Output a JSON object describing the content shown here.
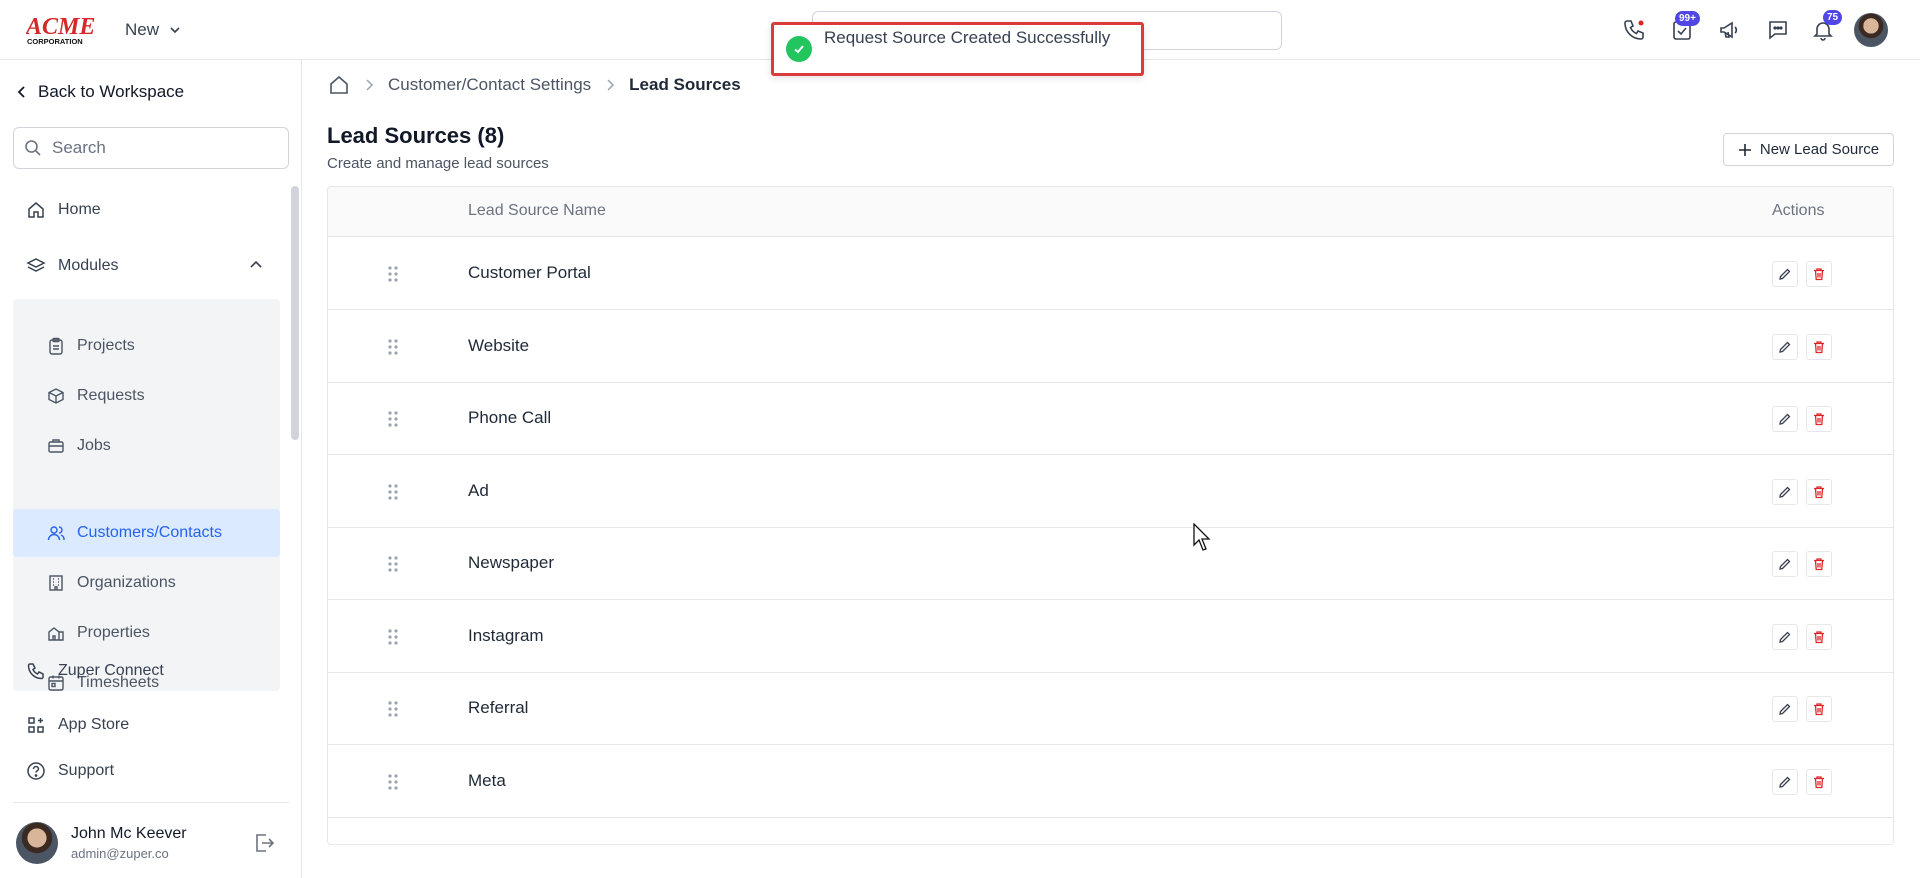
{
  "header": {
    "logo_text": "ACME CORPORATION",
    "new_label": "New",
    "notifications_badge": "75",
    "tasks_badge": "99+"
  },
  "toast": {
    "message": "Request Source Created Successfully"
  },
  "sidebar": {
    "back_label": "Back to Workspace",
    "search_placeholder": "Search",
    "home_label": "Home",
    "modules_label": "Modules",
    "modules_items": [
      {
        "label": "Projects"
      },
      {
        "label": "Requests"
      },
      {
        "label": "Jobs"
      },
      {
        "label": "Customers/Contacts"
      },
      {
        "label": "Organizations"
      },
      {
        "label": "Properties"
      },
      {
        "label": "Timesheets"
      }
    ],
    "zuper_connect_label": "Zuper Connect",
    "app_store_label": "App Store",
    "support_label": "Support",
    "user": {
      "name": "John Mc Keever",
      "email": "admin@zuper.co"
    }
  },
  "breadcrumb": {
    "parent": "Customer/Contact Settings",
    "current": "Lead Sources"
  },
  "page": {
    "title": "Lead Sources (8)",
    "subtitle": "Create and manage lead sources",
    "new_button_label": "New Lead Source"
  },
  "table": {
    "col_name": "Lead Source Name",
    "col_actions": "Actions",
    "rows": [
      {
        "name": "Customer Portal"
      },
      {
        "name": "Website"
      },
      {
        "name": "Phone Call"
      },
      {
        "name": "Ad"
      },
      {
        "name": "Newspaper"
      },
      {
        "name": "Instagram"
      },
      {
        "name": "Referral"
      },
      {
        "name": "Meta"
      }
    ]
  },
  "colors": {
    "accent": "#2563eb",
    "active_bg": "#dbeafe",
    "toast_border": "#dc3b3b",
    "success": "#22c55e",
    "delete": "#dc2626",
    "badge": "#4f46e5"
  }
}
